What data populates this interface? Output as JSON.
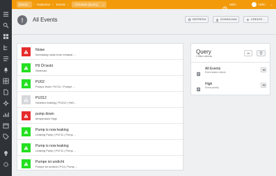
{
  "topbar": {
    "breadcrumbs": [
      "[Stack]",
      "Inspection",
      "Events",
      "All Events (Query)"
    ],
    "help_label": "Hello",
    "user_label": "Hello"
  },
  "header": {
    "title": "All Events",
    "refresh_label": "REFRESH",
    "download_label": "DOWNLOAD",
    "create_label": "CREATE..."
  },
  "events": [
    {
      "title": "Noise",
      "subtitle": "Increasing noise from exhaust ...",
      "severity": "red",
      "icon": "warning-icon"
    },
    {
      "title": "P9 Öl leckt",
      "subtitle": "Ölverlust",
      "severity": "green",
      "icon": "warning-icon"
    },
    {
      "title": "PU02",
      "subtitle": "Pumpe leckt / P4711 / Pumpe ...",
      "severity": "green",
      "icon": "warning-icon"
    },
    {
      "title": "PU312",
      "subtitle": "Gearbox leaking | PU312 | Heil...",
      "severity": "gray",
      "icon": "warning-icon"
    },
    {
      "title": "pump down",
      "subtitle": "temperature High",
      "severity": "red",
      "icon": "warning-icon"
    },
    {
      "title": "Pump is now leaking",
      "subtitle": "Leaking Pump | P4711 | Pump ...",
      "severity": "green",
      "icon": "warning-icon"
    },
    {
      "title": "Pump is now leaking",
      "subtitle": "Leaking Pump | P4711 | Pump ...",
      "severity": "green",
      "icon": "warning-icon"
    },
    {
      "title": "Pumpe ist undicht",
      "subtitle": "Pumpe ist undicht | P13 | Pump ...",
      "severity": "green",
      "icon": "warning-icon"
    }
  ],
  "query": {
    "title": "Query",
    "subtitle": "2 filter criteria",
    "count": "16",
    "items": [
      {
        "title": "All Events",
        "subtitle": "Event states: failure",
        "icon": "document-icon"
      },
      {
        "title": "High",
        "subtitle": "Event priority",
        "icon": "document-icon"
      }
    ]
  },
  "colors": {
    "accent": "#f29a0a",
    "severity_red": "#e52b2b",
    "severity_green": "#22e01f",
    "severity_gray": "#d5d7da",
    "rail": "#2f3338"
  }
}
